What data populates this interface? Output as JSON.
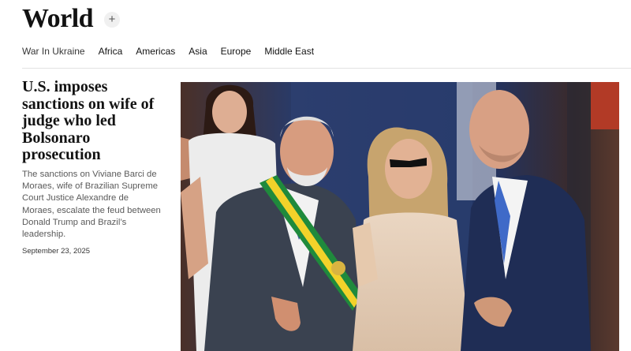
{
  "section": {
    "title": "World",
    "follow_label": "+"
  },
  "subnav": [
    "War In Ukraine",
    "Africa",
    "Americas",
    "Asia",
    "Europe",
    "Middle East"
  ],
  "story": {
    "headline": "U.S. imposes sanctions on wife of judge who led Bolsonaro prosecution",
    "summary": "The sanctions on Viviane Barci de Moraes, wife of Brazilian Supreme Court Justice Alexandre de Moraes, escalate the feud between Donald Trump and Brazil’s leadership.",
    "date": "September 23, 2025"
  },
  "colors": {
    "text": "#121212",
    "muted": "#5a5a5a",
    "divider": "#e2e2e2"
  },
  "icons": {
    "follow": "plus-icon"
  }
}
